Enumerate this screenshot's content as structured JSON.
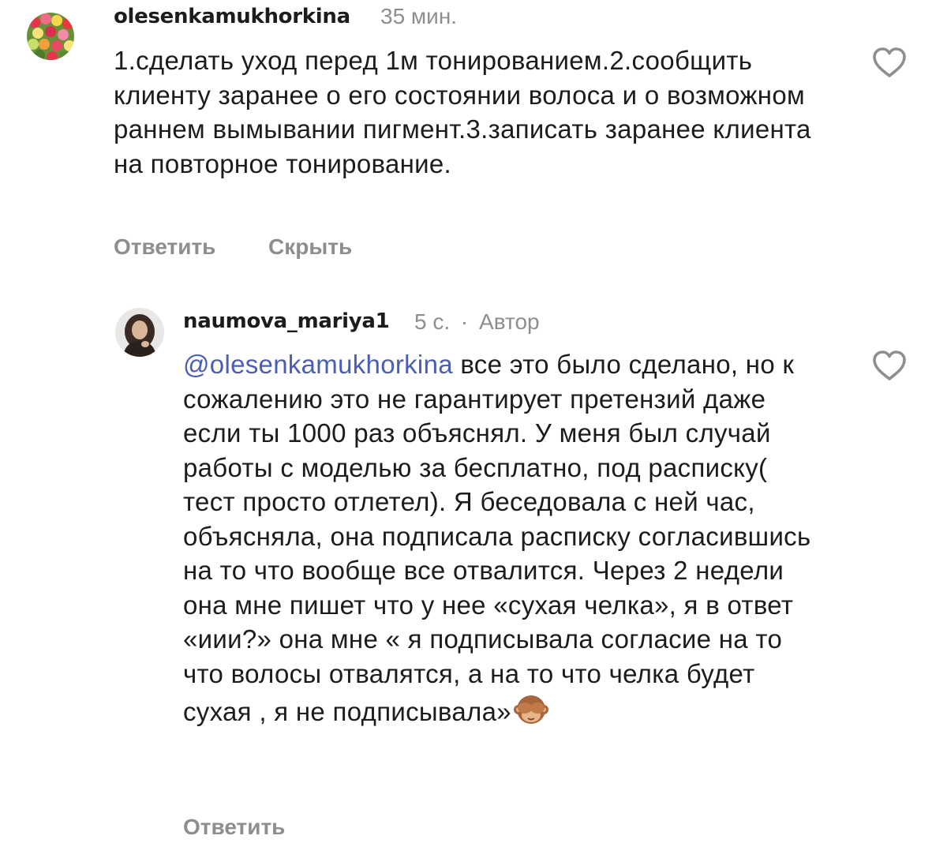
{
  "comments": [
    {
      "username": "olesenkamukhorkina",
      "time": "35 мин.",
      "text": "1.сделать уход перед 1м тонированием.2.сообщить клиенту заранее о его состоянии волоса и о возможном раннем вымывании пигмент.3.записать заранее клиента на повторное тонирование.",
      "actions": {
        "reply": "Ответить",
        "hide": "Скрыть"
      },
      "avatar_icon": "tulips-photo",
      "like_icon": "heart-outline-icon"
    }
  ],
  "replies": [
    {
      "username": "naumova_mariya1",
      "time": "5 с.",
      "separator": "·",
      "author_badge": "Автор",
      "mention": "@olesenkamukhorkina",
      "text_after_mention": " все это было сделано, но к сожалению это не гарантирует претензий даже если ты 1000 раз объяснял. У меня был случай работы с моделью за бесплатно, под расписку( тест просто отлетел). Я беседовала с ней час, объясняла, она подписала расписку согласившись на то что вообще все отвалится. Через 2 недели она мне пишет что у нее «сухая челка», я в ответ «иии?» она мне « я подписывала согласие на то что волосы отвалятся, а на то что челка будет сухая , я не подписывала»",
      "emoji_icon": "see-no-evil-monkey-icon",
      "actions": {
        "reply": "Ответить"
      },
      "avatar_icon": "profile-photo",
      "like_icon": "heart-outline-icon"
    }
  ],
  "colors": {
    "text": "#1c1c1c",
    "secondary": "#8e8e8e",
    "mention": "#4a5fb3"
  }
}
